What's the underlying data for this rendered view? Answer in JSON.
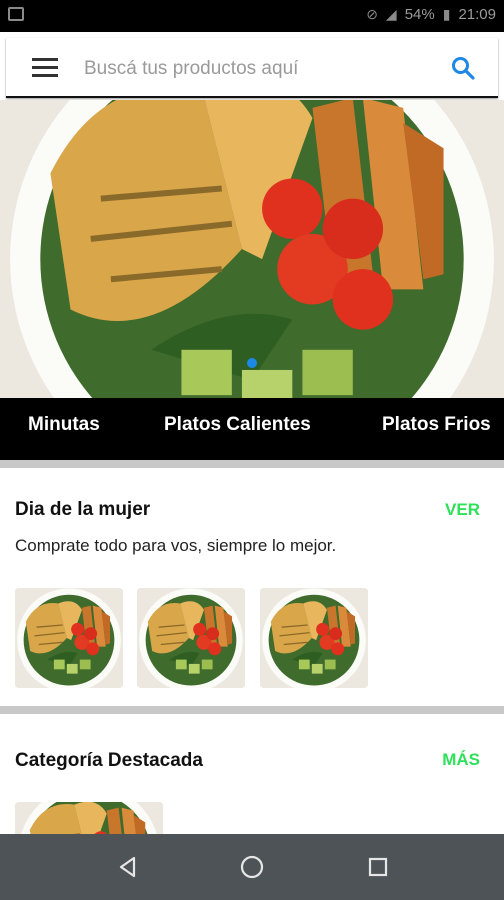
{
  "status_bar": {
    "battery": "54%",
    "time": "21:09"
  },
  "search": {
    "placeholder": "Buscá tus productos aquí"
  },
  "categories": [
    "Minutas",
    "Platos Calientes",
    "Platos Frios"
  ],
  "sections": [
    {
      "title": "Dia de la mujer",
      "action": "VER",
      "subtitle": "Comprate todo para vos, siempre lo mejor."
    },
    {
      "title": "Categoría Destacada",
      "action": "MÁS"
    }
  ],
  "colors": {
    "accent_green": "#2ee05a",
    "search_blue": "#1e88e5",
    "tab_bar": "#000000",
    "nav_bar": "#4d5357"
  }
}
